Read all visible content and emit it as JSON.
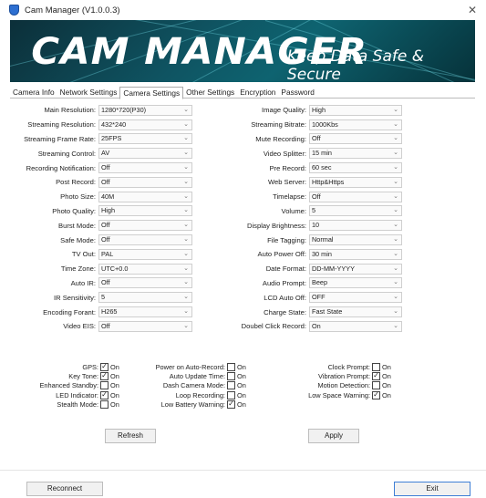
{
  "window": {
    "title": "Cam Manager (V1.0.0.3)"
  },
  "banner": {
    "title": "CAM MANAGER",
    "tagline": "Keep Data Safe & Secure"
  },
  "tabs": [
    {
      "label": "Camera Info",
      "active": false
    },
    {
      "label": "Network Settings",
      "active": false
    },
    {
      "label": "Camera Settings",
      "active": true
    },
    {
      "label": "Other Settings",
      "active": false
    },
    {
      "label": "Encryption",
      "active": false
    },
    {
      "label": "Password",
      "active": false
    }
  ],
  "left_settings": [
    {
      "label": "Main Resolution:",
      "value": "1280*720(P30)"
    },
    {
      "label": "Streaming Resolution:",
      "value": "432*240"
    },
    {
      "label": "Streaming Frame Rate:",
      "value": "25FPS"
    },
    {
      "label": "Streaming Control:",
      "value": "AV"
    },
    {
      "label": "Recording Notification:",
      "value": "Off"
    },
    {
      "label": "Post Record:",
      "value": "Off"
    },
    {
      "label": "Photo Size:",
      "value": "40M"
    },
    {
      "label": "Photo Quality:",
      "value": "High"
    },
    {
      "label": "Burst Mode:",
      "value": "Off"
    },
    {
      "label": "Safe Mode:",
      "value": "Off"
    },
    {
      "label": "TV Out:",
      "value": "PAL"
    },
    {
      "label": "Time Zone:",
      "value": "UTC+0.0"
    },
    {
      "label": "Auto IR:",
      "value": "Off"
    },
    {
      "label": "IR Sensitivity:",
      "value": "5"
    },
    {
      "label": "Encoding Forant:",
      "value": "H265"
    },
    {
      "label": "Video EIS:",
      "value": "Off"
    }
  ],
  "right_settings": [
    {
      "label": "Image Quality:",
      "value": "High"
    },
    {
      "label": "Streaming Bitrate:",
      "value": "1000Kbs"
    },
    {
      "label": "Mute Recording:",
      "value": "Off"
    },
    {
      "label": "Video Splitter:",
      "value": "15 min"
    },
    {
      "label": "Pre Record:",
      "value": "60 sec"
    },
    {
      "label": "Web Server:",
      "value": "Http&Https"
    },
    {
      "label": "Timelapse:",
      "value": "Off"
    },
    {
      "label": "Volume:",
      "value": "5"
    },
    {
      "label": "Display Brightness:",
      "value": "10"
    },
    {
      "label": "File Tagging:",
      "value": "Normal"
    },
    {
      "label": "Auto Power Off:",
      "value": "30 min"
    },
    {
      "label": "Date Format:",
      "value": "DD-MM-YYYY"
    },
    {
      "label": "Audio Prompt:",
      "value": "Beep"
    },
    {
      "label": "LCD Auto Off:",
      "value": "OFF"
    },
    {
      "label": "Charge State:",
      "value": "Fast State"
    },
    {
      "label": "Doubel Click Record:",
      "value": "On"
    }
  ],
  "checks_col1": [
    {
      "label": "GPS:",
      "checked": true,
      "on_label": "On"
    },
    {
      "label": "Key Tone:",
      "checked": true,
      "on_label": "On"
    },
    {
      "label": "Enhanced Standby:",
      "checked": false,
      "on_label": "On"
    },
    {
      "label": "LED Indicator:",
      "checked": true,
      "on_label": "On"
    },
    {
      "label": "Stealth Mode:",
      "checked": false,
      "on_label": "On"
    }
  ],
  "checks_col2": [
    {
      "label": "Power on Auto-Record:",
      "checked": false,
      "on_label": "On"
    },
    {
      "label": "Auto Update Time:",
      "checked": false,
      "on_label": "On"
    },
    {
      "label": "Dash Camera Mode:",
      "checked": false,
      "on_label": "On"
    },
    {
      "label": "Loop Recording:",
      "checked": false,
      "on_label": "On"
    },
    {
      "label": "Low Battery Warning:",
      "checked": true,
      "on_label": "On"
    }
  ],
  "checks_col3": [
    {
      "label": "Clock Prompt:",
      "checked": false,
      "on_label": "On"
    },
    {
      "label": "Vibration Prompt:",
      "checked": true,
      "on_label": "On"
    },
    {
      "label": "Motion Detection:",
      "checked": false,
      "on_label": "On"
    },
    {
      "label": "Low Space Warning:",
      "checked": true,
      "on_label": "On"
    }
  ],
  "buttons": {
    "refresh": "Refresh",
    "apply": "Apply",
    "reconnect": "Reconnect",
    "exit": "Exit"
  },
  "icons": {
    "app": "shield-icon",
    "close": "close-icon",
    "dropdown": "chevron-down-icon",
    "check": "checkmark-icon"
  },
  "colors": {
    "banner_dark": "#0c2f39",
    "banner_mid": "#0f5462",
    "check_mark": "#222222"
  }
}
